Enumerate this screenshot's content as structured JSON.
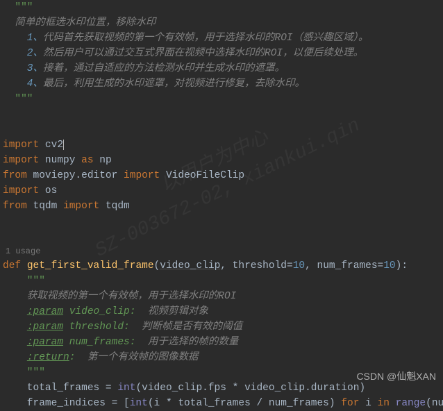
{
  "watermark": {
    "line1": "以用户为中心",
    "line2": "SZ-003672-02, xiankui.qin"
  },
  "credit": "CSDN @仙魁XAN",
  "usage_hint": "1 usage",
  "code": {
    "l01a": "  \"\"\"",
    "l02": "  简单的框选水印位置，移除水印",
    "l03_ord": "    1、",
    "l03_txt": "代码首先获取视频的第一个有效帧，用于选择水印的ROI（感兴趣区域）。",
    "l04_ord": "    2、",
    "l04_txt": "然后用户可以通过交互式界面在视频中选择水印的ROI，以便后续处理。",
    "l05_ord": "    3、",
    "l05_txt": "接着，通过自适应的方法检测水印并生成水印的遮罩。",
    "l06_ord": "    4、",
    "l06_txt": "最后，利用生成的水印遮罩，对视频进行修复，去除水印。",
    "l07": "  \"\"\"",
    "imp1_kw": "import",
    "imp1_mod": " cv2",
    "imp2_kw": "import",
    "imp2_mod": " numpy ",
    "imp2_as": "as",
    "imp2_alias": " np",
    "imp3_from": "from",
    "imp3_mod": " moviepy.editor ",
    "imp3_kw": "import",
    "imp3_name": " VideoFileClip",
    "imp4_kw": "import",
    "imp4_mod": " os",
    "imp5_from": "from",
    "imp5_mod": " tqdm ",
    "imp5_kw": "import",
    "imp5_name": " tqdm",
    "def_kw": "def ",
    "def_name": "get_first_valid_frame",
    "def_paren_open": "(",
    "def_p1": "video_clip",
    "def_comma1": ", ",
    "def_p2": "threshold",
    "def_eq1": "=",
    "def_v1": "10",
    "def_comma2": ", ",
    "def_p3": "num_frames",
    "def_eq2": "=",
    "def_v2": "10",
    "def_close": "):",
    "doc_open": "    \"\"\"",
    "doc_l1": "    获取视频的第一个有效帧，用于选择水印的ROI",
    "doc_tag_param": ":param",
    "doc_p1_name": " video_clip:",
    "doc_p1_desc": "  视频剪辑对象",
    "doc_p2_name": " threshold:",
    "doc_p2_desc": "  判断帧是否有效的阈值",
    "doc_p3_name": " num_frames:",
    "doc_p3_desc": "  用于选择的帧的数量",
    "doc_tag_return": ":return",
    "doc_ret_colon": ":",
    "doc_ret_desc": "  第一个有效帧的图像数据",
    "doc_close": "    \"\"\"",
    "body1_a": "    total_frames = ",
    "body1_int": "int",
    "body1_b": "(video_clip.fps * video_clip.duration)",
    "body2_a": "    frame_indices = [",
    "body2_int": "int",
    "body2_b": "(i * total_frames / num_frames) ",
    "body2_for": "for",
    "body2_c": " i ",
    "body2_in": "in",
    "body2_d": " ",
    "body2_range": "range",
    "body2_e": "(num_fram"
  }
}
